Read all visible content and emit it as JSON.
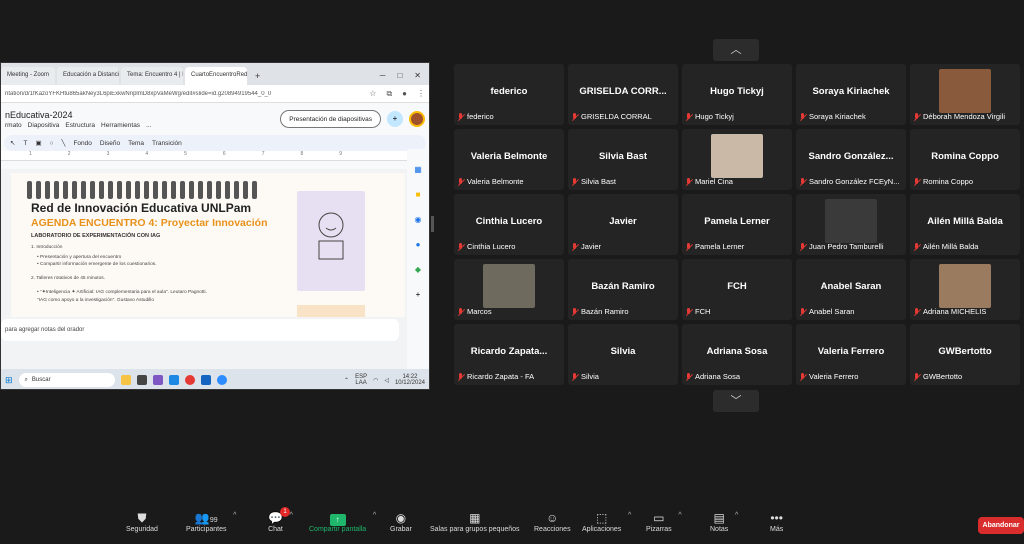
{
  "share": {
    "tabs": [
      "Meeting - Zoom",
      "Educación a Distancia",
      "Tema: Encuentro 4 | Ra...",
      "CuartoEncuentroRedIn..."
    ],
    "url": "ntation/d/1fKazoYFKHtu865akNey3L6piExkwNnplmD8xpVaMeWg/edit#slide=id.g20894919544_0_0",
    "doc_title": "nEducativa-2024",
    "doc_menu": [
      "rmato",
      "Diapositiva",
      "Estructura",
      "Herramientas",
      "..."
    ],
    "present_label": "Presentación de diapositivas",
    "toolbar": [
      "Fondo",
      "Diseño",
      "Tema",
      "Transición"
    ],
    "ruler": [
      "1",
      "2",
      "3",
      "4",
      "5",
      "6",
      "7",
      "8",
      "9"
    ],
    "slide": {
      "title1": "Red de Innovación Educativa UNLPam",
      "title2": "AGENDA ENCUENTRO 4: Proyectar Innovación",
      "subtitle": "LABORATORIO DE EXPERIMENTACIÓN CON IAG",
      "lines": [
        "1. Introducción",
        "•   Presentación y apertura del encuentro",
        "•   Compartir información emergente de los cuestionarios.",
        "2. Talleres rotativos de 45 minutos.",
        "•   \"✦Inteligencia ✦ Artificial: IAG complementaria para el aula\". Leutaro Pagnotti.",
        "    \"IAG como apoyo a la investigación\". Gustavo Astudillo"
      ]
    },
    "notes": "para agregar notas del orador",
    "taskbar": {
      "search": "Buscar",
      "lang1": "ESP",
      "lang2": "LAA",
      "time": "14:22",
      "date": "10/12/2024"
    }
  },
  "gallery": {
    "participants": [
      {
        "big": "federico",
        "label": "federico"
      },
      {
        "big": "GRISELDA CORR...",
        "label": "GRISELDA CORRAL"
      },
      {
        "big": "Hugo Tickyj",
        "label": "Hugo Tickyj"
      },
      {
        "big": "Soraya Kiriachek",
        "label": "Soraya Kiriachek"
      },
      {
        "big": "",
        "label": "Déborah Mendoza Virgili",
        "photo": "#8a5a3c"
      },
      {
        "big": "Valeria Belmonte",
        "label": "Valeria Belmonte"
      },
      {
        "big": "Silvia Bast",
        "label": "Silvia Bast"
      },
      {
        "big": "",
        "label": "Mariel Cina",
        "photo": "#c9b9a6"
      },
      {
        "big": "Sandro González...",
        "label": "Sandro González FCEyN..."
      },
      {
        "big": "Romina Coppo",
        "label": "Romina Coppo"
      },
      {
        "big": "Cinthia Lucero",
        "label": "Cinthia Lucero"
      },
      {
        "big": "Javier",
        "label": "Javier"
      },
      {
        "big": "Pamela Lerner",
        "label": "Pamela Lerner"
      },
      {
        "big": "",
        "label": "Juan Pedro Tamburelli",
        "photo": "#3a3a3a"
      },
      {
        "big": "Ailén Millá Balda",
        "label": "Ailén Millá Balda"
      },
      {
        "big": "",
        "label": "Marcos",
        "photo": "#6e6a5e"
      },
      {
        "big": "Bazán Ramiro",
        "label": "Bazán Ramiro"
      },
      {
        "big": "FCH",
        "label": "FCH"
      },
      {
        "big": "Anabel Saran",
        "label": "Anabel Saran"
      },
      {
        "big": "",
        "label": "Adriana MICHELIS",
        "photo": "#9b7b60"
      },
      {
        "big": "Ricardo Zapata...",
        "label": "Ricardo Zapata - FA"
      },
      {
        "big": "Silvia",
        "label": "Silvia"
      },
      {
        "big": "Adriana Sosa",
        "label": "Adriana Sosa"
      },
      {
        "big": "Valeria Ferrero",
        "label": "Valeria Ferrero"
      },
      {
        "big": "GWBertotto",
        "label": "GWBertotto"
      }
    ]
  },
  "controls": {
    "security": "Seguridad",
    "participants": "Participantes",
    "participants_count": "99",
    "chat": "Chat",
    "chat_badge": "1",
    "share": "Compartir pantalla",
    "record": "Grabar",
    "rooms": "Salas para grupos pequeños",
    "reactions": "Reacciones",
    "apps": "Aplicaciones",
    "whiteboards": "Pizarras",
    "notes": "Notas",
    "more": "Más",
    "leave": "Abandonar"
  }
}
